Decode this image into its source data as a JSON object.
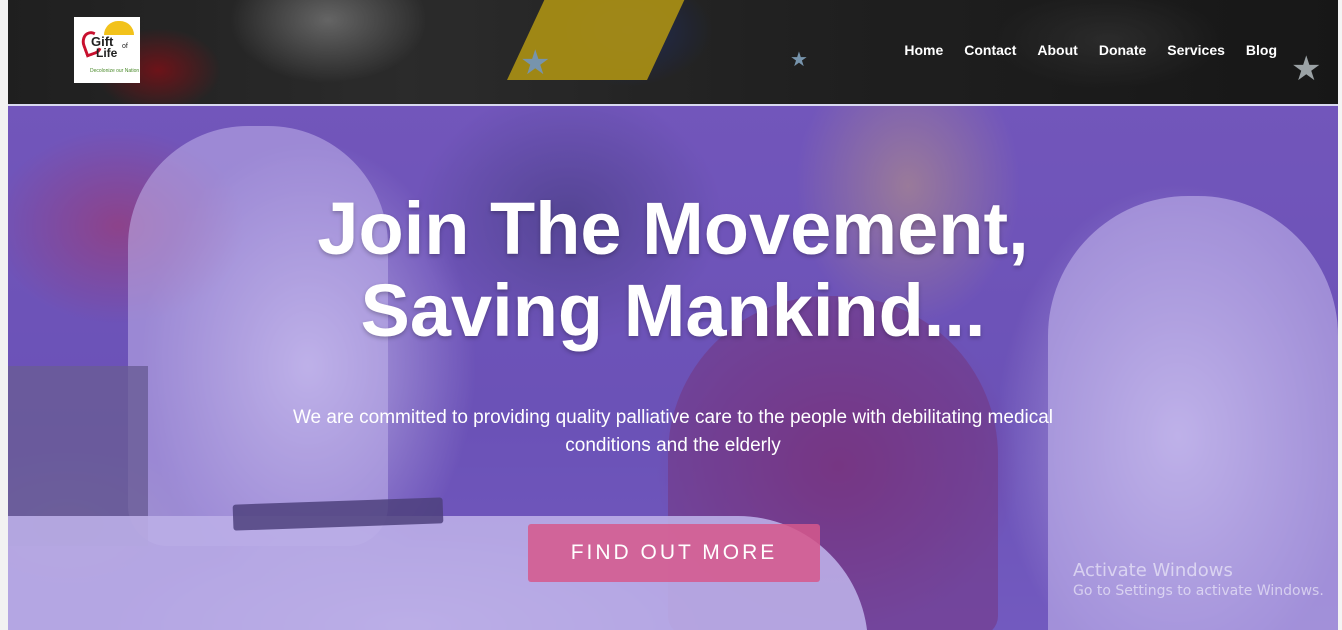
{
  "header": {
    "logo": {
      "title_line1": "Gift",
      "title_of": "of",
      "title_line2": "Life",
      "tagline": "Decolonize our Nation"
    },
    "nav": [
      {
        "label": "Home"
      },
      {
        "label": "Contact"
      },
      {
        "label": "About"
      },
      {
        "label": "Donate"
      },
      {
        "label": "Services"
      },
      {
        "label": "Blog"
      }
    ]
  },
  "hero": {
    "title_line1": "Join The Movement,",
    "title_line2": "Saving Mankind...",
    "subtitle": "We are committed to providing quality palliative care to the people with debilitating medical conditions and the elderly",
    "cta_label": "FIND OUT MORE"
  },
  "watermark": {
    "line1": "Activate Windows",
    "line2": "Go to Settings to activate Windows."
  },
  "colors": {
    "overlay": "#7d5fd2",
    "cta": "#d6588c",
    "nav_text": "#ffffff"
  }
}
